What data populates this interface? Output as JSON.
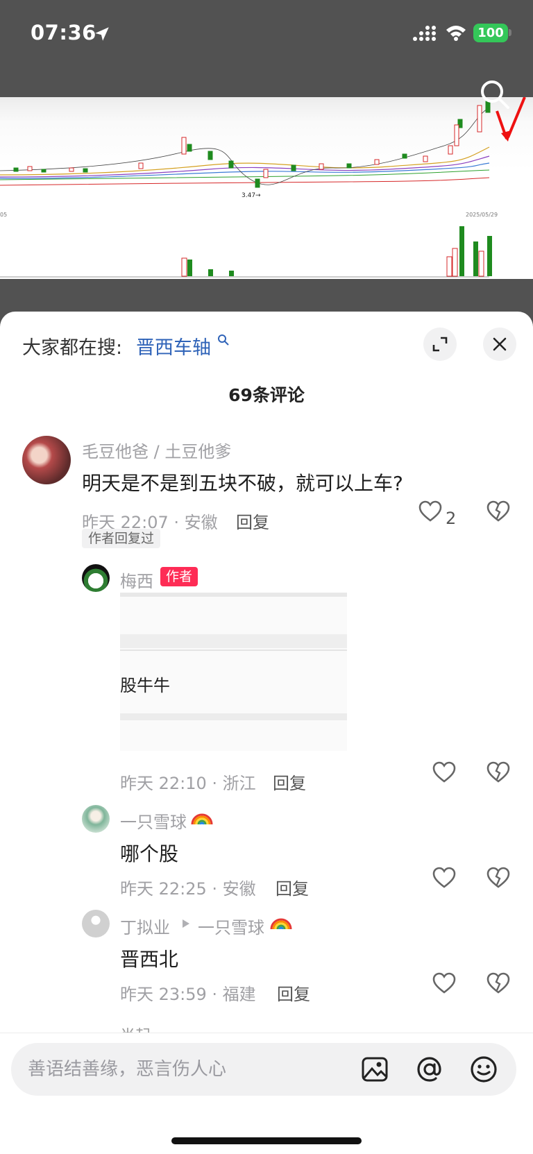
{
  "status_bar": {
    "time": "07:36",
    "battery": "100"
  },
  "video": {
    "chart_labels": {
      "low_price": "3.47→",
      "start_date": "05",
      "end_date": "2025/05/29"
    }
  },
  "sheet": {
    "everyone_searching_prefix": "大家都在搜:",
    "everyone_searching_link": "晋西车轴",
    "comment_count": "69条评论"
  },
  "comments": [
    {
      "user": "毛豆他爸 / 土豆他爹",
      "text": "明天是不是到五块不破，就可以上车?",
      "time_location": "昨天 22:07 · 安徽",
      "reply_label": "回复",
      "likes": "2",
      "author_replied_tag": "作者回复过"
    }
  ],
  "replies": [
    {
      "user": "梅西",
      "badge": "作者",
      "image_text": "股牛牛",
      "time_location": "昨天 22:10 · 浙江",
      "reply_label": "回复"
    },
    {
      "user": "一只雪球",
      "text": "哪个股",
      "time_location": "昨天 22:25 · 安徽",
      "reply_label": "回复"
    },
    {
      "user": "丁拟业",
      "reply_to": "一只雪球",
      "text": "晋西北",
      "time_location": "昨天 23:59 · 福建",
      "reply_label": "回复"
    }
  ],
  "partial_next_name": "肖起",
  "input": {
    "placeholder": "善语结善缘，恶言伤人心"
  },
  "colors": {
    "accent_link": "#2f63b8",
    "author_badge": "#fe2c55",
    "battery": "#34c759"
  }
}
